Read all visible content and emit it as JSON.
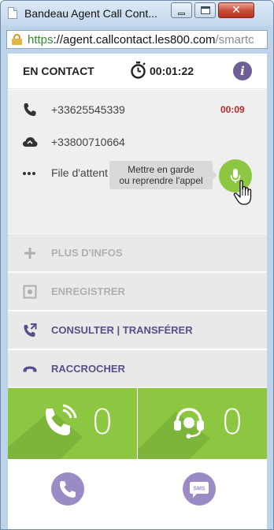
{
  "window": {
    "title": "Bandeau Agent Call Cont..."
  },
  "address": {
    "scheme": "https",
    "domain": "://agent.callcontact.les800.com",
    "path": "/smartc"
  },
  "header": {
    "status": "EN CONTACT",
    "timer": "00:01:22",
    "info_icon": "i"
  },
  "call": {
    "caller_number": "+33625545339",
    "caller_duration": "00:09",
    "called_number": "+33800710664",
    "queue_label": "File d'attent",
    "tooltip_line1": "Mettre en garde",
    "tooltip_line2": "ou reprendre l'appel"
  },
  "actions": [
    {
      "label": "PLUS D'INFOS",
      "icon": "plus-icon",
      "enabled": false
    },
    {
      "label": "ENREGISTRER",
      "icon": "record-icon",
      "enabled": false
    },
    {
      "label": "CONSULTER | TRANSFÉRER",
      "icon": "transfer-icon",
      "enabled": true
    },
    {
      "label": "RACCROCHER",
      "icon": "hangup-icon",
      "enabled": true
    }
  ],
  "counters": {
    "calls": "0",
    "agents": "0"
  },
  "colors": {
    "green": "#8dc742",
    "purple": "#5a4c8e",
    "light_purple": "#9a8bc4",
    "red": "#c0242b"
  }
}
